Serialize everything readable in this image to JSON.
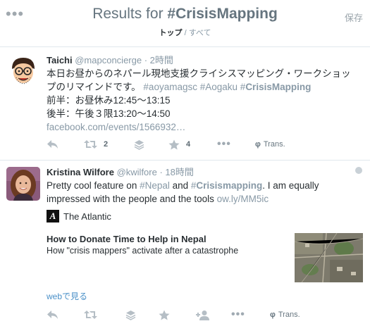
{
  "header": {
    "more_icon": "ellipsis-icon",
    "title_prefix": "Results for ",
    "title_query": "#CrisisMapping",
    "save_label": "保存",
    "tab_top": "トップ",
    "tab_sep": " / ",
    "tab_all": "すべて"
  },
  "tweets": [
    {
      "name": "Taichi",
      "handle": "@mapconcierge",
      "sep": " · ",
      "time": "2時間",
      "line1": "本日お昼からのネパール現地支援クライシスマッピング・ワークショッ",
      "line2_text": "プのリマインドです。",
      "tag1": "#aoyamagsc",
      "tag2": "#Aogaku",
      "tag3_hash": "#",
      "tag3_word": "CrisisMapping",
      "line3": "前半：お昼休み12:45〜13:15",
      "line4": "後半：午後３限13:20〜14:50",
      "link": "facebook.com/events/1566932…",
      "retweets": "2",
      "favorites": "4",
      "trans": "Trans."
    },
    {
      "name": "Kristina Wilfore",
      "handle": "@kwilfore",
      "sep": " · ",
      "time": "18時間",
      "text1": "Pretty cool feature on ",
      "hash_nepal_h": "#",
      "hash_nepal_w": "Nepal",
      "text2": " and ",
      "hash_cm_h": "#",
      "hash_cm_w": "Crisismapping",
      "text3": ". I am equally",
      "line2": "impressed with the people and the tools ",
      "link": "ow.ly/MM5ic",
      "card_logo": "A",
      "card_source": "The Atlantic",
      "card_title": "How to Donate Time to Help in Nepal",
      "card_desc": "How \"crisis mappers\" activate after a catastrophe",
      "web_link": "webで見る",
      "trans": "Trans."
    }
  ]
}
